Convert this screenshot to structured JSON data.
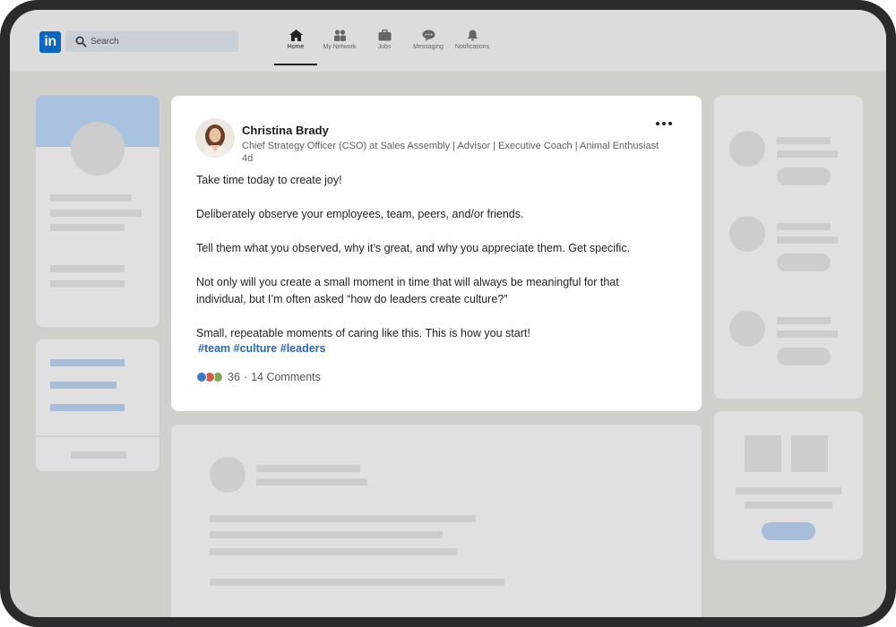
{
  "nav": {
    "logo_text": "in",
    "search_placeholder": "Search",
    "items": [
      {
        "label": "Home",
        "icon": "home-icon",
        "active": true
      },
      {
        "label": "My Network",
        "icon": "network-icon",
        "active": false
      },
      {
        "label": "Jobs",
        "icon": "briefcase-icon",
        "active": false
      },
      {
        "label": "Messaging",
        "icon": "messaging-icon",
        "active": false
      },
      {
        "label": "Notifications",
        "icon": "bell-icon",
        "active": false
      }
    ]
  },
  "post": {
    "author": {
      "name": "Christina Brady",
      "headline": "Chief Strategy Officer (CSO) at Sales Assembly | Advisor | Executive Coach | Animal Enthusiast",
      "age": "4d"
    },
    "paragraphs": [
      "Take time today to create joy!",
      "Deliberately observe your employees, team, peers, and/or friends.",
      "Tell them what you observed, why it’s great, and why you appreciate them.  Get specific.",
      "Not only will you create a small moment in time that will always be meaningful for that",
      "individual, but I’m often asked “how do leaders create culture?”",
      "Small, repeatable moments of caring like this. This is how you start!"
    ],
    "hashtags": [
      "#team",
      "#culture",
      "#leaders"
    ],
    "reaction_count": "36",
    "separator": "·",
    "comments": "14 Comments"
  },
  "colors": {
    "brand": "#0a66c2",
    "hashtag": "#2b67b3",
    "placeholder_blue": "#a7bdd8"
  }
}
